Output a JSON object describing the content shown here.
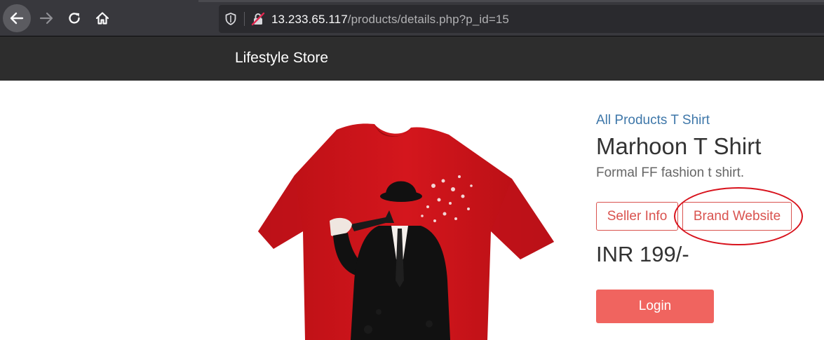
{
  "browser": {
    "url_host": "13.233.65.117",
    "url_path": "/products/details.php?p_id=15"
  },
  "site": {
    "brand": "Lifestyle Store"
  },
  "product": {
    "breadcrumb": [
      "All Products",
      "T Shirt"
    ],
    "name": "Marhoon T Shirt",
    "description": "Formal FF fashion t shirt.",
    "seller_info_label": "Seller Info",
    "brand_website_label": "Brand Website",
    "price": "INR 199/-",
    "login_label": "Login"
  },
  "colors": {
    "accent": "#d9534f",
    "login_bg": "#f0645f",
    "link": "#3e77a9",
    "annotation": "#d8121c"
  }
}
